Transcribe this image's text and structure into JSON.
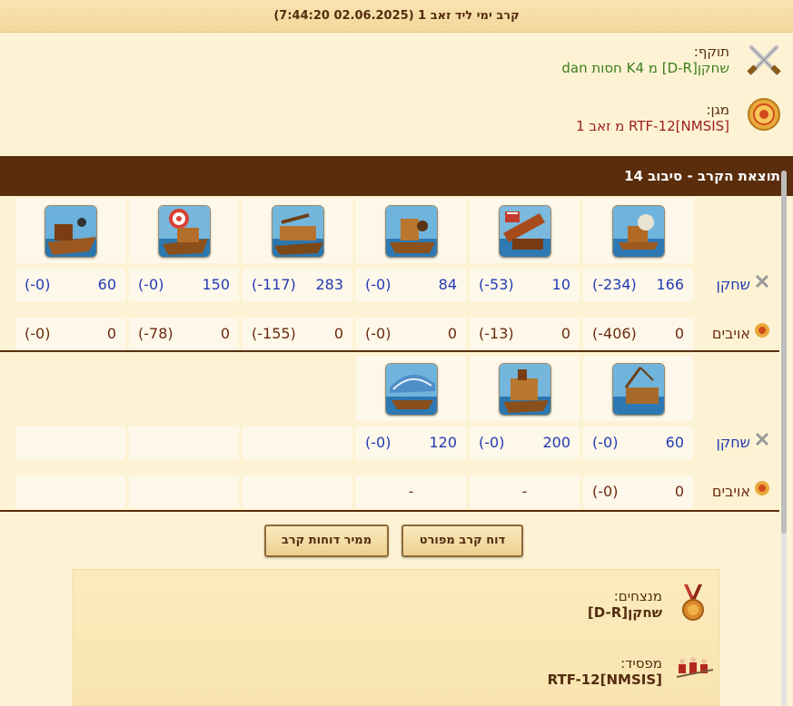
{
  "report": {
    "title": "קרב ימי ליד זאב 1 (02.06.2025 7:44:20)",
    "attacker_label": "תוקף:",
    "attacker_name": "שחקן[D-R] מ K4 חסות dan",
    "defender_label": "מגן:",
    "defender_name": "RTF-12[NMSIS] מ זאב 1",
    "summary_title": "תוצאת הקרב - סיבוב 14"
  },
  "rows": {
    "player_label": "שחקן",
    "enemy_label": "אויבים"
  },
  "units_top": [
    {
      "unit_icon": "ram-ship",
      "player": {
        "value": "166",
        "loss": "(-234)"
      },
      "enemy": {
        "value": "0",
        "loss": "(-406)"
      }
    },
    {
      "unit_icon": "fire-ship",
      "player": {
        "value": "10",
        "loss": "(-53)"
      },
      "enemy": {
        "value": "0",
        "loss": "(-13)"
      }
    },
    {
      "unit_icon": "steam-ram",
      "player": {
        "value": "84",
        "loss": "(-0)"
      },
      "enemy": {
        "value": "0",
        "loss": "(-0)"
      }
    },
    {
      "unit_icon": "ballista-ship",
      "player": {
        "value": "283",
        "loss": "(-117)"
      },
      "enemy": {
        "value": "0",
        "loss": "(-155)"
      }
    },
    {
      "unit_icon": "catapult-ship",
      "player": {
        "value": "150",
        "loss": "(-0)"
      },
      "enemy": {
        "value": "0",
        "loss": "(-78)"
      }
    },
    {
      "unit_icon": "mortar-ship",
      "player": {
        "value": "60",
        "loss": "(-0)"
      },
      "enemy": {
        "value": "0",
        "loss": "(-0)"
      }
    }
  ],
  "units_bottom": [
    {
      "unit_icon": "diving-boat",
      "player": {
        "value": "60",
        "loss": "(-0)"
      },
      "enemy": {
        "value": "0",
        "loss": "(-0)"
      }
    },
    {
      "unit_icon": "rocket-ship",
      "player": {
        "value": "200",
        "loss": "(-0)"
      },
      "enemy": {
        "value": "",
        "loss": "-"
      }
    },
    {
      "unit_icon": "paddle-speedboat",
      "player": {
        "value": "120",
        "loss": "(-0)"
      },
      "enemy": {
        "value": "",
        "loss": "-"
      }
    }
  ],
  "buttons": {
    "detailed": "דוח קרב מפורט",
    "converter": "ממיר דוחות קרב"
  },
  "outcome": {
    "winners_label": "מנצחים:",
    "winners_name": "שחקן[D-R]",
    "loser_label": "מפסיד:",
    "loser_name": "RTF-12[NMSIS]"
  },
  "colors": {
    "header_bar": "#5a2e0c",
    "player_text": "#2439b3",
    "enemy_text": "#6a2a0e",
    "attacker_name": "#3b7e1b",
    "defender_name": "#9b1c1c"
  }
}
